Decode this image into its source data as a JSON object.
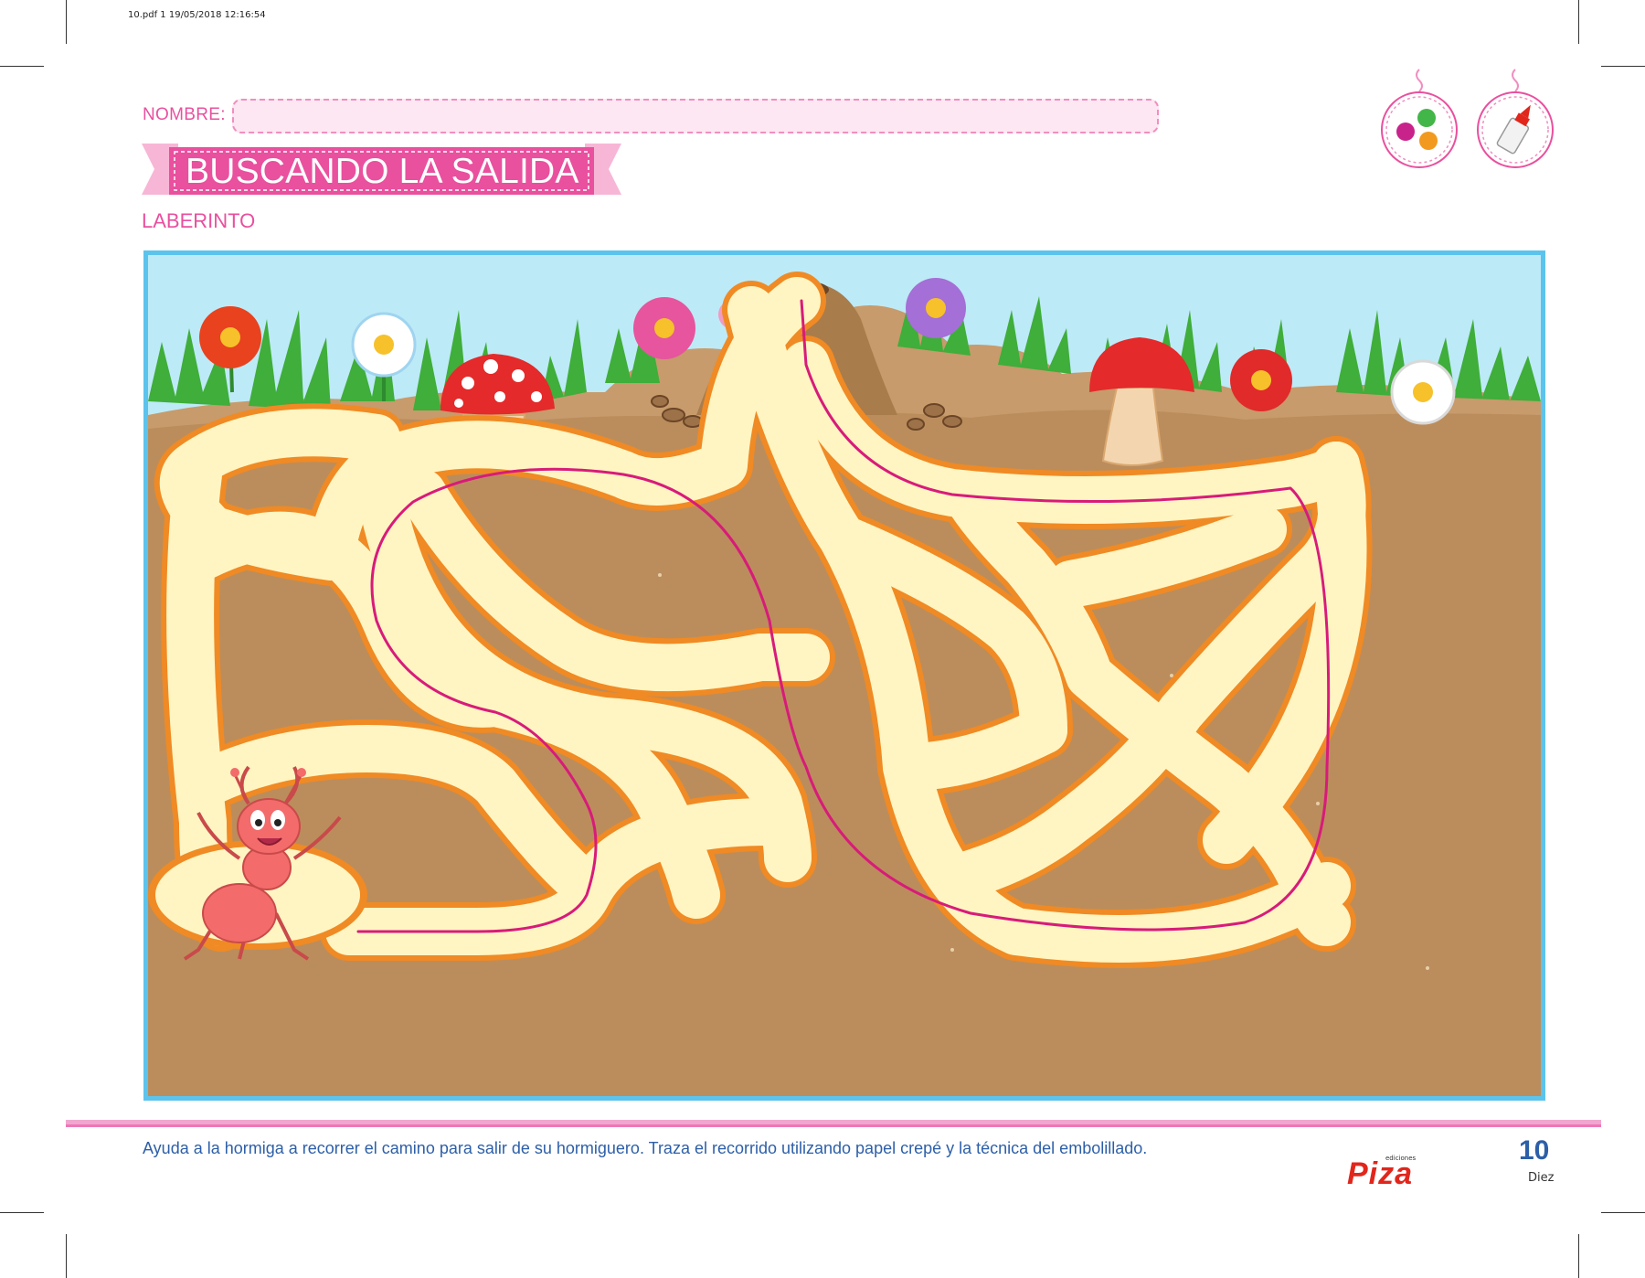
{
  "print_header": "10.pdf   1   19/05/2018   12:16:54",
  "form": {
    "name_label": "NOMBRE:"
  },
  "title": "BUSCANDO LA SALIDA",
  "subtitle": "LABERINTO",
  "badges": [
    {
      "icon": "paint-palette-icon"
    },
    {
      "icon": "glue-bottle-icon"
    }
  ],
  "instructions": "Ayuda a la hormiga a recorrer el camino para salir de su hormiguero. Traza el recorrido utilizando papel crepé y la técnica del embolillado.",
  "publisher": {
    "small": "ediciones",
    "name": "Piza"
  },
  "page": {
    "number": "10",
    "word": "Diez"
  },
  "colors": {
    "accent_pink": "#e9509e",
    "title_blue": "#2d5fa8",
    "sky": "#bdeaf7",
    "soil": "#bb8d5c",
    "tunnel": "#fff5c2",
    "tunnel_edge": "#f08a24",
    "route_line": "#d81b7a",
    "ant": "#f36b6b"
  }
}
